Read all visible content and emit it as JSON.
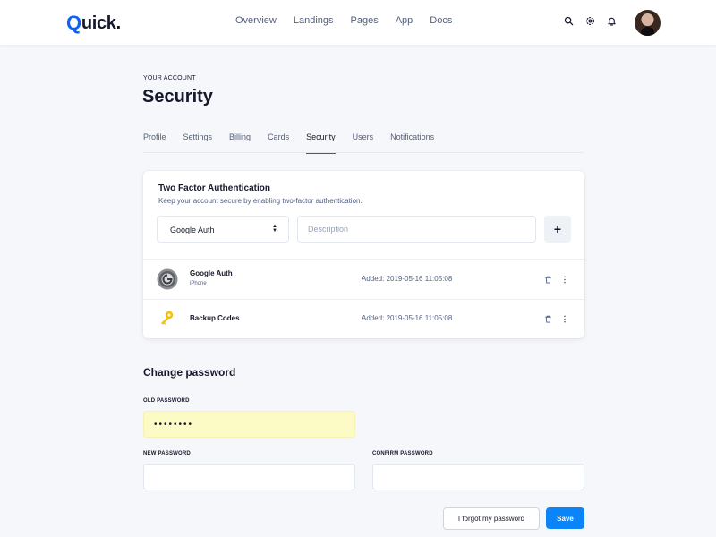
{
  "header": {
    "logo_text": "Quick",
    "logo_dot": ".",
    "nav": [
      "Overview",
      "Landings",
      "Pages",
      "App",
      "Docs"
    ],
    "icons": [
      "search-icon",
      "gear-icon",
      "bell-icon"
    ]
  },
  "page": {
    "eyebrow": "YOUR ACCOUNT",
    "title": "Security",
    "tabs": [
      "Profile",
      "Settings",
      "Billing",
      "Cards",
      "Security",
      "Users",
      "Notifications"
    ],
    "active_tab": "Security"
  },
  "two_factor": {
    "title": "Two Factor Authentication",
    "subtitle": "Keep your account secure by enabling two-factor authentication.",
    "select_value": "Google Auth",
    "description_placeholder": "Description",
    "add_label": "+",
    "methods": [
      {
        "name": "Google Auth",
        "device": "iPhone",
        "added": "Added: 2019-05-16 11:05:08",
        "icon": "google-auth-icon"
      },
      {
        "name": "Backup Codes",
        "device": "",
        "added": "Added: 2019-05-16 11:05:08",
        "icon": "key-icon"
      }
    ]
  },
  "change_password": {
    "title": "Change password",
    "old_label": "OLD PASSWORD",
    "old_value": "••••••••",
    "new_label": "NEW PASSWORD",
    "new_value": "",
    "confirm_label": "CONFIRM PASSWORD",
    "confirm_value": "",
    "forgot_label": "I forgot my password",
    "save_label": "Save"
  },
  "colors": {
    "brand": "#0b63f6",
    "save_button": "#0b84f7",
    "autofill": "#fdfbc5",
    "key": "#f4c20d"
  }
}
